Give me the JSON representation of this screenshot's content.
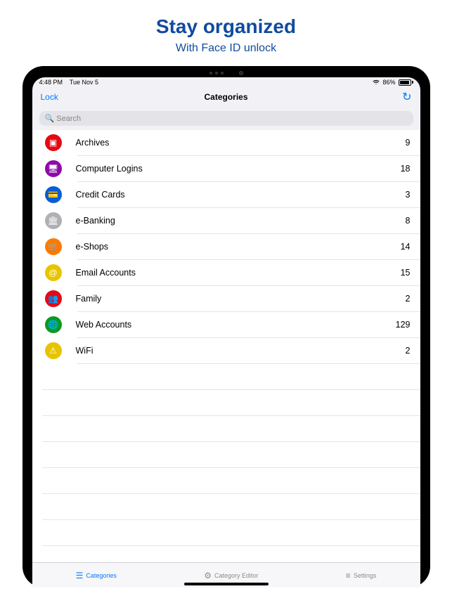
{
  "banner": {
    "title": "Stay organized",
    "subtitle": "With Face ID unlock"
  },
  "status": {
    "time": "4:48 PM",
    "date": "Tue Nov 5",
    "battery": "86%"
  },
  "nav": {
    "lock": "Lock",
    "title": "Categories"
  },
  "search": {
    "placeholder": "Search"
  },
  "categories": [
    {
      "icon": "archive-icon",
      "icon_bg": "#e50914",
      "glyph": "▣",
      "label": "Archives",
      "count": 9
    },
    {
      "icon": "computer-icon",
      "icon_bg": "#8e0aa8",
      "glyph": "🖥",
      "label": "Computer Logins",
      "count": 18
    },
    {
      "icon": "card-icon",
      "icon_bg": "#0a5cd7",
      "glyph": "💳",
      "label": "Credit Cards",
      "count": 3
    },
    {
      "icon": "bank-icon",
      "icon_bg": "#b0b0b4",
      "glyph": "🏛",
      "label": "e-Banking",
      "count": 8
    },
    {
      "icon": "cart-icon",
      "icon_bg": "#ff7a00",
      "glyph": "🛒",
      "label": "e-Shops",
      "count": 14
    },
    {
      "icon": "at-icon",
      "icon_bg": "#e8c400",
      "glyph": "@",
      "label": "Email Accounts",
      "count": 15
    },
    {
      "icon": "family-icon",
      "icon_bg": "#e50914",
      "glyph": "👥",
      "label": "Family",
      "count": 2
    },
    {
      "icon": "globe-icon",
      "icon_bg": "#0a9a1e",
      "glyph": "🌐",
      "label": "Web Accounts",
      "count": 129
    },
    {
      "icon": "wifi-icon",
      "icon_bg": "#e8c400",
      "glyph": "⚠",
      "label": "WiFi",
      "count": 2
    }
  ],
  "tabs": [
    {
      "icon": "list-icon",
      "glyph": "☰",
      "label": "Categories",
      "active": true
    },
    {
      "icon": "editor-icon",
      "glyph": "⚙",
      "label": "Category Editor",
      "active": false
    },
    {
      "icon": "sliders-icon",
      "glyph": "≡",
      "label": "Settings",
      "active": false
    }
  ]
}
